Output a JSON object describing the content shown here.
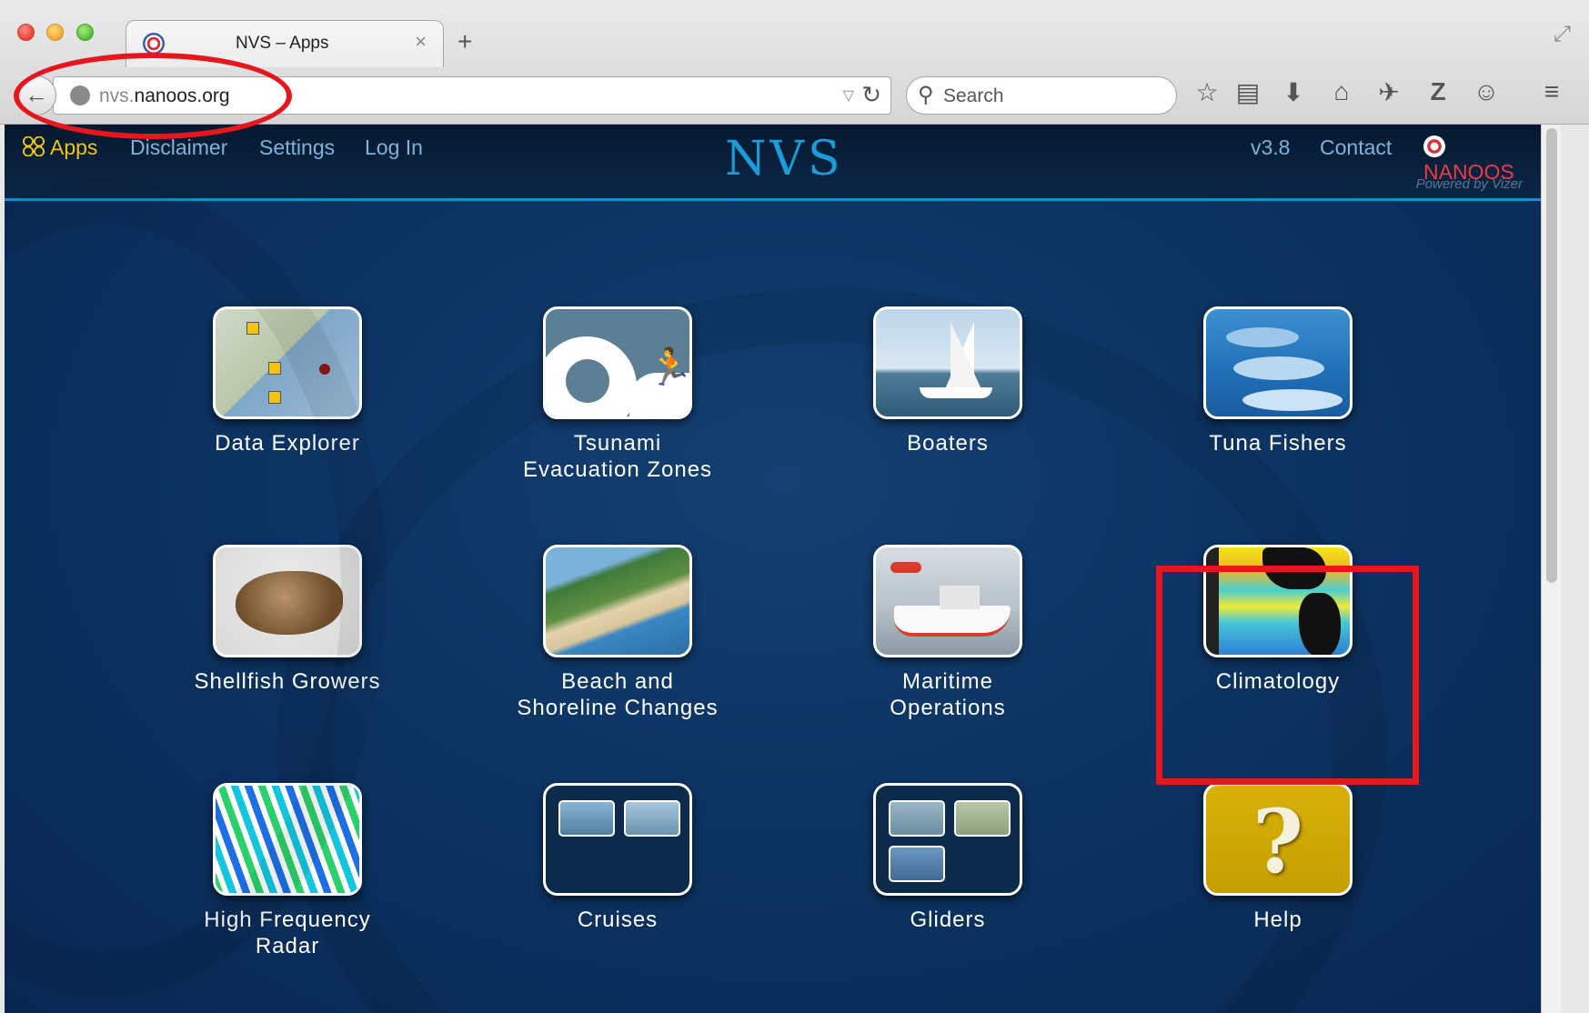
{
  "browser": {
    "tab_title": "NVS – Apps",
    "tab_close": "×",
    "new_tab": "+",
    "url_host_prefix": "nvs.",
    "url_domain": "nanoos.org",
    "search_placeholder": "Search",
    "back": "←",
    "reload": "↻",
    "dropdown": "▽",
    "search_glyph": "⚲",
    "fullscreen": "⤢",
    "toolbar_glyphs": [
      "☆",
      "▤",
      "⬇",
      "⌂",
      "✈",
      "Z",
      "☺",
      "≡"
    ],
    "toolbar_icons": [
      "bookmark-star-icon",
      "reading-list-icon",
      "downloads-icon",
      "home-icon",
      "send-icon",
      "zotero-icon",
      "chat-icon",
      "menu-icon"
    ]
  },
  "site": {
    "nav": {
      "apps": "Apps",
      "disclaimer": "Disclaimer",
      "settings": "Settings",
      "login": "Log In",
      "version": "v3.8",
      "contact": "Contact",
      "nanoos": "NANOOS"
    },
    "logo": "NVS",
    "powered_by": "Powered by Vizer"
  },
  "apps": [
    {
      "label": "Data Explorer"
    },
    {
      "label": "Tsunami\nEvacuation Zones"
    },
    {
      "label": "Boaters"
    },
    {
      "label": "Tuna Fishers"
    },
    {
      "label": "Shellfish Growers"
    },
    {
      "label": "Beach and\nShoreline Changes"
    },
    {
      "label": "Maritime\nOperations"
    },
    {
      "label": "Climatology"
    },
    {
      "label": "High Frequency\nRadar"
    },
    {
      "label": "Cruises"
    },
    {
      "label": "Gliders"
    },
    {
      "label": "Help",
      "glyph": "?"
    }
  ],
  "colors": {
    "accent": "#1b8bd1",
    "apps_active": "#f1c40f",
    "nanoos_red": "#ee3a43",
    "annotation": "#e5161c"
  }
}
